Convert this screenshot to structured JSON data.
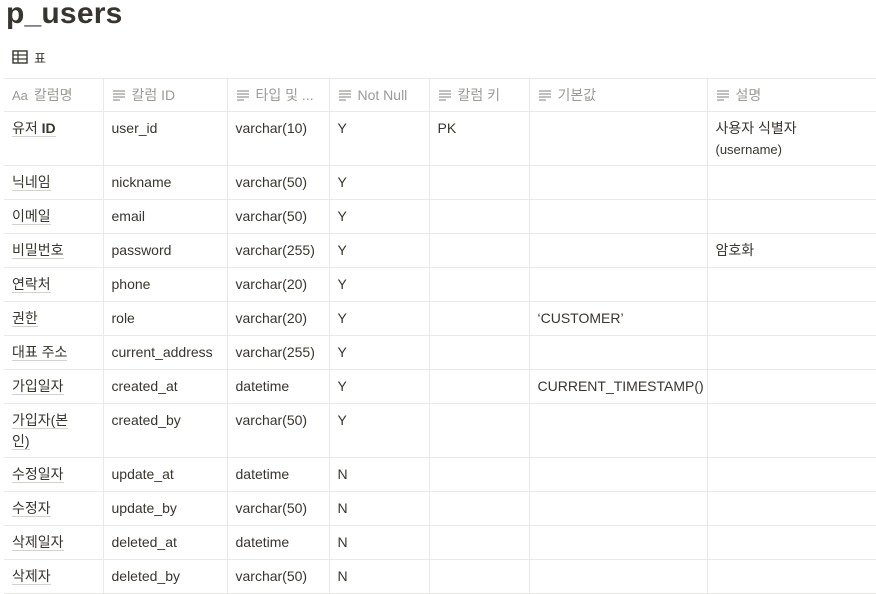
{
  "page": {
    "title": "p_users"
  },
  "view": {
    "label": "표",
    "icon": "table-icon"
  },
  "table": {
    "columns": [
      {
        "label": "칼럼명",
        "icon": "title-aa-icon"
      },
      {
        "label": "칼럼 ID",
        "icon": "text-lines-icon"
      },
      {
        "label": "타입 및 ...",
        "icon": "text-lines-icon"
      },
      {
        "label": "Not Null",
        "icon": "text-lines-icon"
      },
      {
        "label": "칼럼 키",
        "icon": "text-lines-icon"
      },
      {
        "label": "기본값",
        "icon": "text-lines-icon"
      },
      {
        "label": "설명",
        "icon": "text-lines-icon"
      }
    ],
    "rows": [
      {
        "name_prefix": "유저 ",
        "name_bold": "ID",
        "id": "user_id",
        "type": "varchar(10)",
        "not_null": "Y",
        "key": "PK",
        "default": "",
        "desc": "사용자 식별자",
        "desc2": "(username)"
      },
      {
        "name_prefix": "닉네임",
        "name_bold": "",
        "id": "nickname",
        "type": "varchar(50)",
        "not_null": "Y",
        "key": "",
        "default": "",
        "desc": "",
        "desc2": ""
      },
      {
        "name_prefix": "이메일",
        "name_bold": "",
        "id": "email",
        "type": "varchar(50)",
        "not_null": "Y",
        "key": "",
        "default": "",
        "desc": "",
        "desc2": ""
      },
      {
        "name_prefix": "비밀번호",
        "name_bold": "",
        "id": "password",
        "type": "varchar(255)",
        "not_null": "Y",
        "key": "",
        "default": "",
        "desc": "암호화",
        "desc2": ""
      },
      {
        "name_prefix": "연락처",
        "name_bold": "",
        "id": "phone",
        "type": "varchar(20)",
        "not_null": "Y",
        "key": "",
        "default": "",
        "desc": "",
        "desc2": ""
      },
      {
        "name_prefix": "권한",
        "name_bold": "",
        "id": "role",
        "type": "varchar(20)",
        "not_null": "Y",
        "key": "",
        "default": "‘CUSTOMER’",
        "desc": "",
        "desc2": ""
      },
      {
        "name_prefix": "대표 주소",
        "name_bold": "",
        "id": "current_address",
        "type": "varchar(255)",
        "not_null": "Y",
        "key": "",
        "default": "",
        "desc": "",
        "desc2": ""
      },
      {
        "name_prefix": "가입일자",
        "name_bold": "",
        "id": "created_at",
        "type": "datetime",
        "not_null": "Y",
        "key": "",
        "default": "CURRENT_TIMESTAMP()",
        "desc": "",
        "desc2": ""
      },
      {
        "name_prefix": "가입자(본",
        "name_line2": "인)",
        "name_bold": "",
        "id": "created_by",
        "type": "varchar(50)",
        "not_null": "Y",
        "key": "",
        "default": "",
        "desc": "",
        "desc2": ""
      },
      {
        "name_prefix": "수정일자",
        "name_bold": "",
        "id": "update_at",
        "type": "datetime",
        "not_null": "N",
        "key": "",
        "default": "",
        "desc": "",
        "desc2": ""
      },
      {
        "name_prefix": "수정자",
        "name_bold": "",
        "id": "update_by",
        "type": "varchar(50)",
        "not_null": "N",
        "key": "",
        "default": "",
        "desc": "",
        "desc2": ""
      },
      {
        "name_prefix": "삭제일자",
        "name_bold": "",
        "id": "deleted_at",
        "type": "datetime",
        "not_null": "N",
        "key": "",
        "default": "",
        "desc": "",
        "desc2": ""
      },
      {
        "name_prefix": "삭제자",
        "name_bold": "",
        "id": "deleted_by",
        "type": "varchar(50)",
        "not_null": "N",
        "key": "",
        "default": "",
        "desc": "",
        "desc2": ""
      }
    ]
  }
}
